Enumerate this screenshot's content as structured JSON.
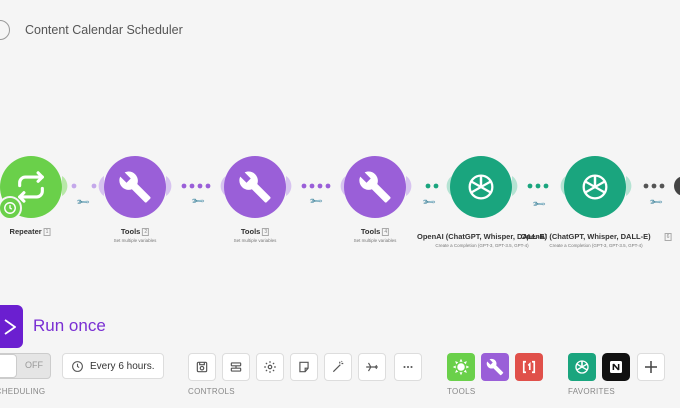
{
  "header": {
    "title": "Content Calendar Scheduler"
  },
  "modules": [
    {
      "name": "Repeater",
      "badge": "1",
      "sub": ""
    },
    {
      "name": "Tools",
      "badge": "2",
      "sub": "Set multiple variables"
    },
    {
      "name": "Tools",
      "badge": "3",
      "sub": "Set multiple variables"
    },
    {
      "name": "Tools",
      "badge": "4",
      "sub": "Set multiple variables"
    },
    {
      "name": "OpenAI (ChatGPT, Whisper, DALL-E)",
      "badge": "5",
      "sub": "Create a Completion (GPT-3, GPT-3.5, GPT-4)"
    },
    {
      "name": "OpenAI (ChatGPT, Whisper, DALL-E)",
      "badge": "6",
      "sub": "Create a Completion (GPT-3, GPT-3.5, GPT-4)"
    }
  ],
  "run": {
    "label": "Run once"
  },
  "scheduling": {
    "toggle_state": "OFF",
    "interval": "Every 6 hours.",
    "label": "SCHEDULING"
  },
  "sections": {
    "controls": "CONTROLS",
    "tools": "TOOLS",
    "favorites": "FAVORITES"
  },
  "colors": {
    "purple": "#9a5fd8",
    "green": "#6ad04a",
    "openai": "#1aa57e",
    "accent": "#6b1fd0"
  }
}
